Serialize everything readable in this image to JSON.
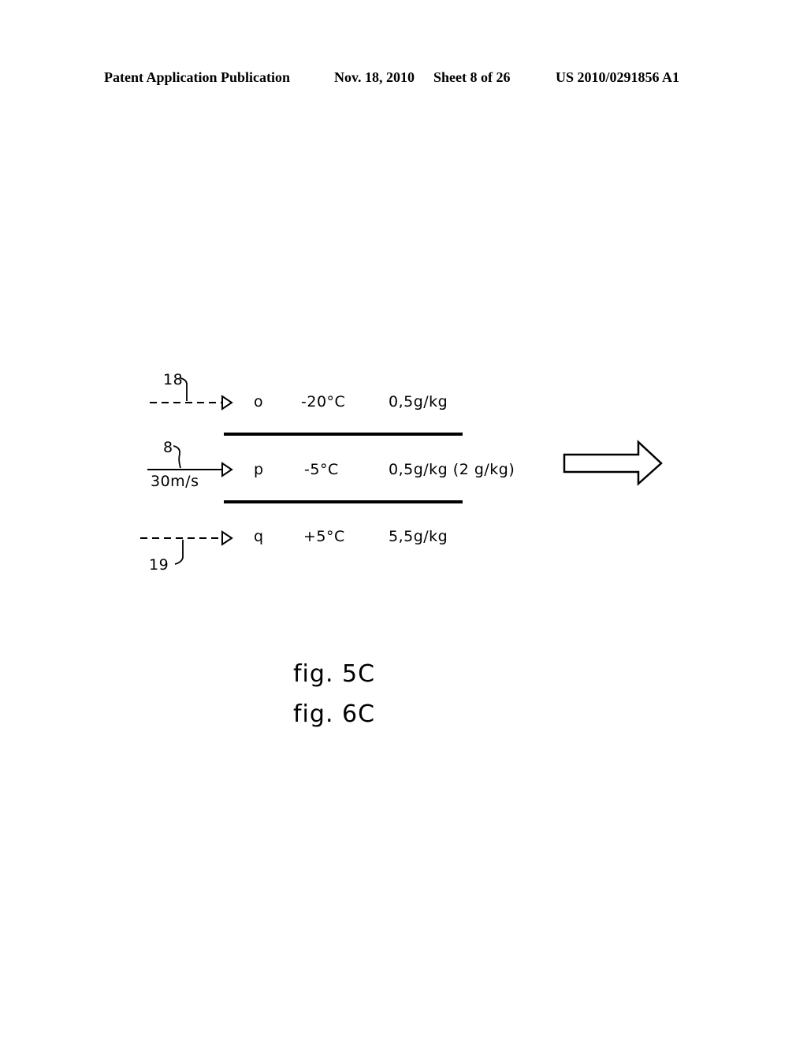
{
  "header": {
    "publication_label": "Patent Application Publication",
    "date": "Nov. 18, 2010",
    "sheet": "Sheet 8 of 26",
    "patent_number": "US 2010/0291856 A1"
  },
  "diagram": {
    "streams": [
      {
        "reference": "18",
        "line_style": "dashed",
        "label": "o",
        "temperature": "-20°C",
        "humidity": "0,5g/kg"
      },
      {
        "reference": "8",
        "line_style": "solid",
        "speed": "30m/s",
        "label": "p",
        "temperature": "-5°C",
        "humidity": "0,5g/kg (2 g/kg)"
      },
      {
        "reference": "19",
        "line_style": "dashed",
        "label": "q",
        "temperature": "+5°C",
        "humidity": "5,5g/kg"
      }
    ],
    "output_arrow": "right-block-arrow-icon"
  },
  "figures": {
    "caption_1": "fig. 5C",
    "caption_2": "fig. 6C"
  }
}
